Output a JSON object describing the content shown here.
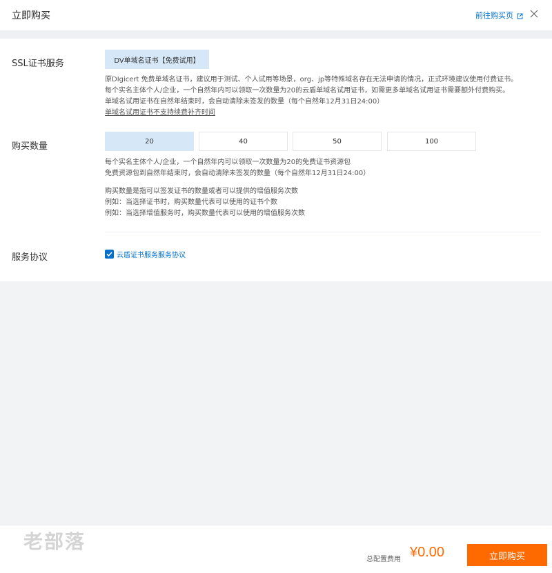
{
  "header": {
    "title": "立即购买",
    "goto_link": "前往购买页",
    "close_icon": "close-icon",
    "external_icon": "external-link-icon"
  },
  "ssl_service": {
    "label": "SSL证书服务",
    "options": [
      {
        "label": "DV单域名证书【免费试用】",
        "selected": true
      }
    ],
    "desc_lines": [
      "原DIgicert 免费单域名证书，建议用于测试、个人试用等场景，org、jp等特殊域名存在无法申请的情况，正式环境建议使用付费证书。",
      "每个实名主体个人/企业，一个自然年内可以领取一次数量为20的云盾单域名试用证书，如需更多单域名试用证书需要额外付费购买。",
      "单域名试用证书在自然年结束时，会自动清除未签发的数量（每个自然年12月31日24:00）"
    ],
    "desc_link": "单域名试用证书不支持续费补齐时间"
  },
  "quantity": {
    "label": "购买数量",
    "options": [
      {
        "label": "20",
        "selected": true
      },
      {
        "label": "40",
        "selected": false
      },
      {
        "label": "50",
        "selected": false
      },
      {
        "label": "100",
        "selected": false
      }
    ],
    "desc_block1": [
      "每个实名主体个人/企业，一个自然年内可以领取一次数量为20的免费证书资源包",
      "免费资源包到自然年结束时，会自动清除未签发的数量（每个自然年12月31日24:00）"
    ],
    "desc_block2": [
      "购买数量是指可以签发证书的数量或者可以提供的增值服务次数",
      "例如：当选择证书时，购买数量代表可以使用的证书个数",
      "例如：当选择增值服务时，购买数量代表可以使用的增值服务次数"
    ]
  },
  "agreement": {
    "label": "服务协议",
    "checked": true,
    "link": "云盾证书服务服务协议"
  },
  "footer": {
    "watermark": "老部落",
    "total_label": "总配置费用",
    "total_price": "¥0.00",
    "buy_button": "立即购买"
  },
  "colors": {
    "accent": "#0070cc",
    "selected_bg": "#d6e8f8",
    "price": "#ff6a00",
    "buy_button_bg": "#ff6a00"
  }
}
